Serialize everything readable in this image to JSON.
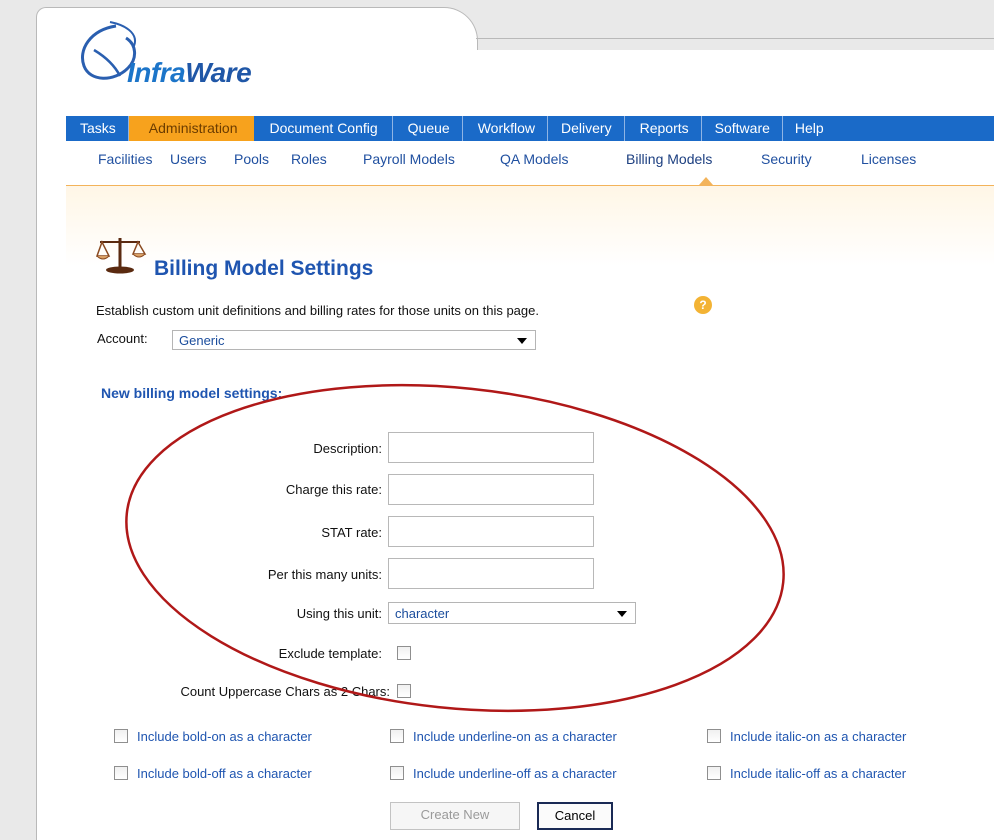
{
  "brand": {
    "logo_text_prefix": "Infra",
    "logo_text_suffix": "Ware"
  },
  "main_nav": [
    {
      "label": "Tasks",
      "active": false
    },
    {
      "label": "Administration",
      "active": true
    },
    {
      "label": "Document Config",
      "active": false
    },
    {
      "label": "Queue",
      "active": false
    },
    {
      "label": "Workflow",
      "active": false
    },
    {
      "label": "Delivery",
      "active": false
    },
    {
      "label": "Reports",
      "active": false
    },
    {
      "label": "Software",
      "active": false
    },
    {
      "label": "Help",
      "active": false
    }
  ],
  "sub_nav": [
    {
      "label": "Facilities"
    },
    {
      "label": "Users"
    },
    {
      "label": "Pools"
    },
    {
      "label": "Roles"
    },
    {
      "label": "Payroll Models"
    },
    {
      "label": "QA Models"
    },
    {
      "label": "Billing Models",
      "active": true
    },
    {
      "label": "Security"
    },
    {
      "label": "Licenses"
    }
  ],
  "page": {
    "title": "Billing Model Settings",
    "description": "Establish custom unit definitions and billing rates for those units on this page.",
    "help_glyph": "?",
    "account_label": "Account:",
    "account_value": "Generic",
    "section_title": "New billing model settings:"
  },
  "form": {
    "description_label": "Description:",
    "charge_label": "Charge this rate:",
    "stat_label": "STAT rate:",
    "per_units_label": "Per this many units:",
    "unit_label": "Using this unit:",
    "unit_value": "character",
    "exclude_template_label": "Exclude template:",
    "count_upper_label": "Count Uppercase Chars as 2 Chars:"
  },
  "checkboxes": {
    "bold_on": "Include bold-on as a character",
    "underline_on": "Include underline-on as a character",
    "italic_on": "Include italic-on as a character",
    "bold_off": "Include bold-off as a character",
    "underline_off": "Include underline-off as a character",
    "italic_off": "Include italic-off as a character"
  },
  "buttons": {
    "create_new": "Create New",
    "cancel": "Cancel"
  },
  "colors": {
    "nav_blue": "#1a6ac8",
    "nav_active": "#f7a21d",
    "title_blue": "#1f55b0",
    "annotation_red": "#b01818"
  },
  "icons": {
    "balance": "balance-scale-icon",
    "help": "help-icon",
    "dropdown": "chevron-down-icon"
  }
}
